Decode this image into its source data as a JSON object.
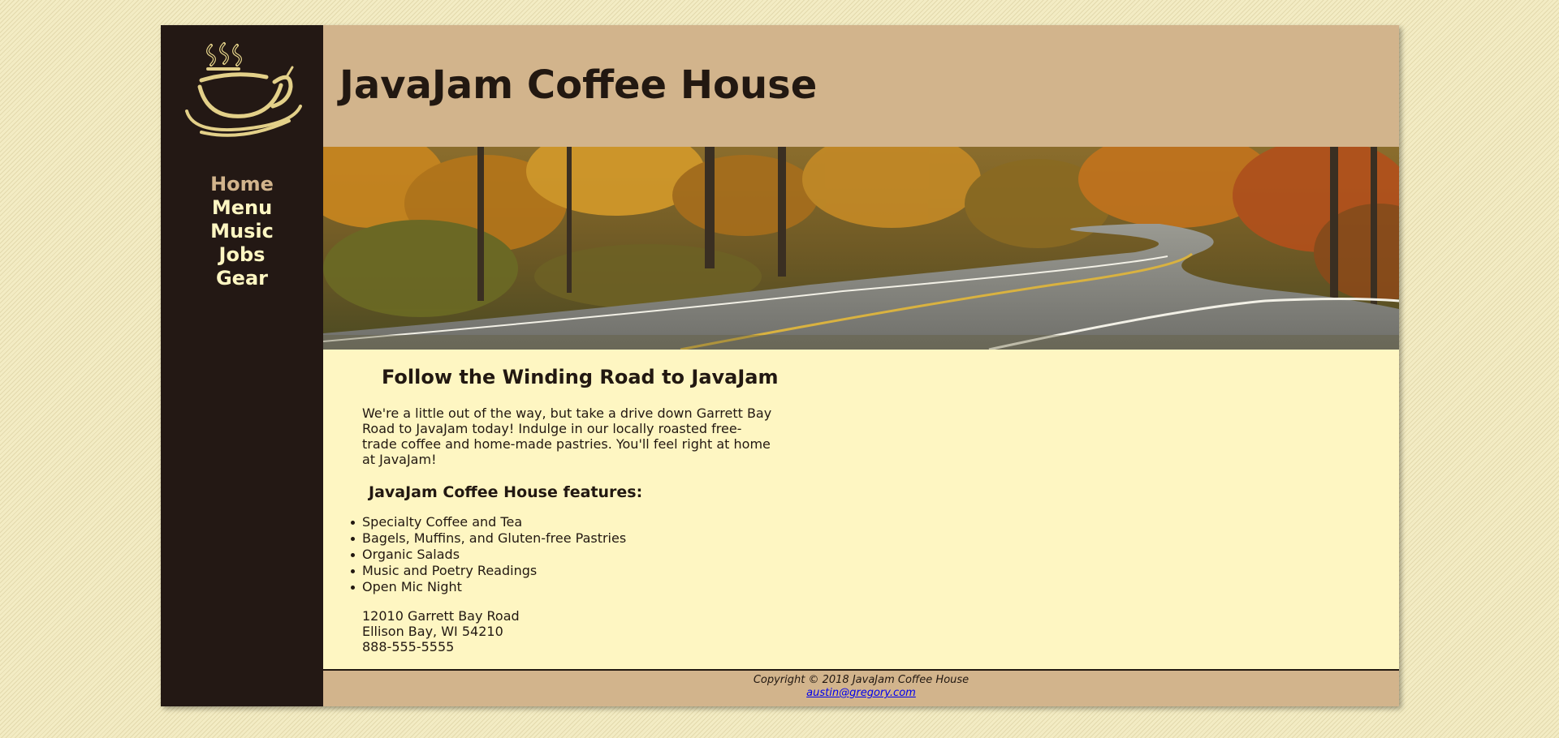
{
  "site": {
    "title": "JavaJam Coffee House"
  },
  "nav": {
    "items": [
      {
        "label": "Home",
        "active": true
      },
      {
        "label": "Menu",
        "active": false
      },
      {
        "label": "Music",
        "active": false
      },
      {
        "label": "Jobs",
        "active": false
      },
      {
        "label": "Gear",
        "active": false
      }
    ]
  },
  "main": {
    "heading": "Follow the Winding Road to JavaJam",
    "intro": "We're a little out of the way, but take a drive down Garrett Bay Road to JavaJam today! Indulge in our locally roasted free-trade coffee and home-made pastries. You'll feel right at home at JavaJam!",
    "features_heading": "JavaJam Coffee House features:",
    "features": [
      "Specialty Coffee and Tea",
      "Bagels, Muffins, and Gluten-free Pastries",
      "Organic Salads",
      "Music and Poetry Readings",
      "Open Mic Night"
    ],
    "address": {
      "street": "12010 Garrett Bay Road",
      "city": "Ellison Bay, WI 54210",
      "phone": "888-555-5555"
    }
  },
  "footer": {
    "copyright": "Copyright © 2018 JavaJam Coffee House",
    "email": "austin@gregory.com"
  },
  "colors": {
    "page_bg": "#f3ecc4",
    "sidebar_bg": "#231814",
    "header_bg": "#d2b48c",
    "content_bg": "#fef6c2",
    "text": "#221811",
    "nav_text": "#fef6c2",
    "nav_active": "#d2b48c"
  },
  "icons": {
    "logo": "steaming-coffee-cup-icon"
  }
}
